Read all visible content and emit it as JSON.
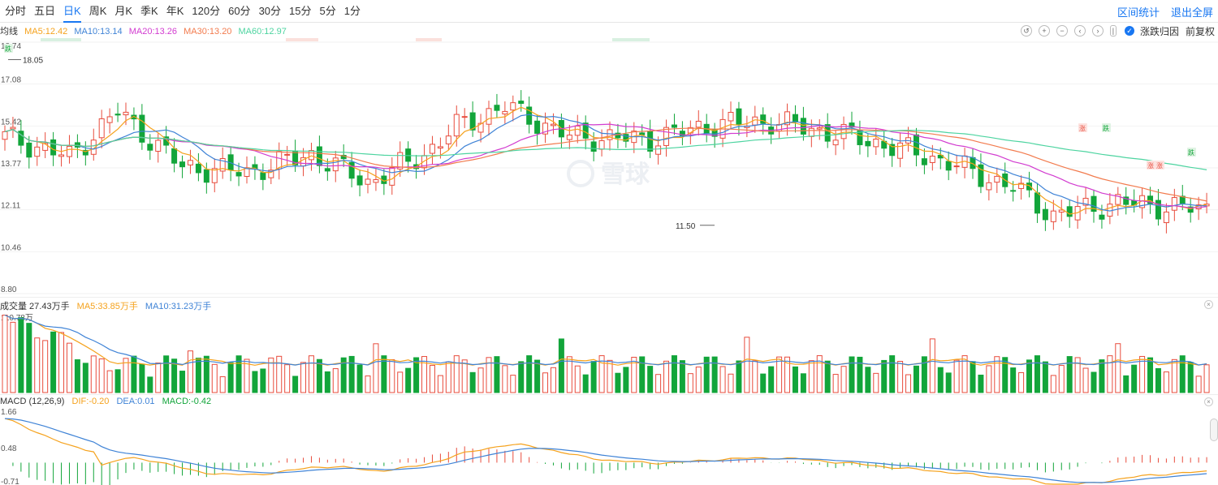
{
  "tabs": [
    {
      "label": "分时"
    },
    {
      "label": "五日"
    },
    {
      "label": "日K"
    },
    {
      "label": "周K"
    },
    {
      "label": "月K"
    },
    {
      "label": "季K"
    },
    {
      "label": "年K"
    },
    {
      "label": "120分"
    },
    {
      "label": "60分"
    },
    {
      "label": "30分"
    },
    {
      "label": "15分"
    },
    {
      "label": "5分"
    },
    {
      "label": "1分"
    }
  ],
  "active_tab": "日K",
  "actions": {
    "range_stats": "区间统计",
    "exit_fullscreen": "退出全屏"
  },
  "toolbar": {
    "reset_icon": "undo-icon",
    "zoom_in_icon": "plus-icon",
    "zoom_out_icon": "minus-icon",
    "prev_icon": "chevron-left-icon",
    "next_icon": "chevron-right-icon",
    "pause_icon": "pause-icon",
    "rise_fall_label": "涨跌归因",
    "rise_fall_checked": true,
    "adjust_label": "前复权"
  },
  "watermark": "雪球",
  "colors": {
    "up": "#e84c3d",
    "down": "#12a53a",
    "ma5": "#f5a21d",
    "ma10": "#3f83d6",
    "ma20": "#d23cd0",
    "ma30": "#f27b4e",
    "ma60": "#4dd4a0",
    "accent": "#1877f2"
  },
  "ma_legend": {
    "label": "均线",
    "items": [
      {
        "text": "MA5:12.42",
        "color": "#f5a21d"
      },
      {
        "text": "MA10:13.14",
        "color": "#3f83d6"
      },
      {
        "text": "MA20:13.26",
        "color": "#d23cd0"
      },
      {
        "text": "MA30:13.20",
        "color": "#f27b4e"
      },
      {
        "text": "MA60:12.97",
        "color": "#4dd4a0"
      }
    ]
  },
  "vol_legend": {
    "label": "成交量 27.43万手",
    "ma5": "MA5:33.85万手",
    "ma10": "MA10:31.23万手"
  },
  "macd_legend": {
    "label": "MACD (12,26,9)",
    "dif": "DIF:-0.20",
    "dea": "DEA:0.01",
    "macd": "MACD:-0.42"
  },
  "price_markers": {
    "high": "18.05",
    "low": "11.50"
  },
  "chart_data": [
    {
      "type": "candlestick",
      "name": "price",
      "y_axis_ticks": [
        "18.74",
        "17.08",
        "15.42",
        "13.77",
        "12.11",
        "10.46",
        "8.80"
      ],
      "ylim": [
        8.8,
        18.74
      ],
      "latest": {
        "ma5": 12.42,
        "ma10": 13.14,
        "ma20": 13.26,
        "ma30": 13.2,
        "ma60": 12.97
      },
      "high": 18.05,
      "low": 11.5,
      "badges": [
        {
          "text": "跌",
          "kind": "down"
        },
        {
          "text": "涨",
          "kind": "up"
        },
        {
          "text": "跌",
          "kind": "down"
        },
        {
          "text": "涨",
          "kind": "up"
        },
        {
          "text": "涨",
          "kind": "up"
        },
        {
          "text": "跌",
          "kind": "down"
        }
      ]
    },
    {
      "type": "bar",
      "name": "volume",
      "y_axis_ticks": [
        "110.78万"
      ],
      "latest": 27.43,
      "ma5": 33.85,
      "ma10": 31.23,
      "unit": "万手"
    },
    {
      "type": "bar",
      "name": "macd",
      "y_axis_ticks": [
        "1.66",
        "0.48",
        "-0.71"
      ],
      "latest": {
        "dif": -0.2,
        "dea": 0.01,
        "macd": -0.42
      }
    }
  ]
}
